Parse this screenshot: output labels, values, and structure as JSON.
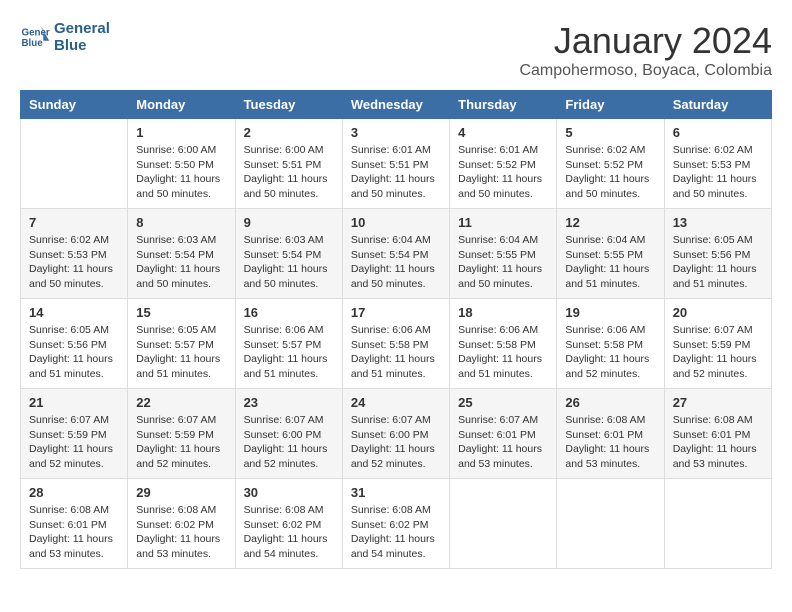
{
  "header": {
    "logo_line1": "General",
    "logo_line2": "Blue",
    "month_year": "January 2024",
    "location": "Campohermoso, Boyaca, Colombia"
  },
  "days_of_week": [
    "Sunday",
    "Monday",
    "Tuesday",
    "Wednesday",
    "Thursday",
    "Friday",
    "Saturday"
  ],
  "weeks": [
    [
      {
        "day": "",
        "sunrise": "",
        "sunset": "",
        "daylight": ""
      },
      {
        "day": "1",
        "sunrise": "6:00 AM",
        "sunset": "5:50 PM",
        "daylight": "11 hours and 50 minutes."
      },
      {
        "day": "2",
        "sunrise": "6:00 AM",
        "sunset": "5:51 PM",
        "daylight": "11 hours and 50 minutes."
      },
      {
        "day": "3",
        "sunrise": "6:01 AM",
        "sunset": "5:51 PM",
        "daylight": "11 hours and 50 minutes."
      },
      {
        "day": "4",
        "sunrise": "6:01 AM",
        "sunset": "5:52 PM",
        "daylight": "11 hours and 50 minutes."
      },
      {
        "day": "5",
        "sunrise": "6:02 AM",
        "sunset": "5:52 PM",
        "daylight": "11 hours and 50 minutes."
      },
      {
        "day": "6",
        "sunrise": "6:02 AM",
        "sunset": "5:53 PM",
        "daylight": "11 hours and 50 minutes."
      }
    ],
    [
      {
        "day": "7",
        "sunrise": "6:02 AM",
        "sunset": "5:53 PM",
        "daylight": "11 hours and 50 minutes."
      },
      {
        "day": "8",
        "sunrise": "6:03 AM",
        "sunset": "5:54 PM",
        "daylight": "11 hours and 50 minutes."
      },
      {
        "day": "9",
        "sunrise": "6:03 AM",
        "sunset": "5:54 PM",
        "daylight": "11 hours and 50 minutes."
      },
      {
        "day": "10",
        "sunrise": "6:04 AM",
        "sunset": "5:54 PM",
        "daylight": "11 hours and 50 minutes."
      },
      {
        "day": "11",
        "sunrise": "6:04 AM",
        "sunset": "5:55 PM",
        "daylight": "11 hours and 50 minutes."
      },
      {
        "day": "12",
        "sunrise": "6:04 AM",
        "sunset": "5:55 PM",
        "daylight": "11 hours and 51 minutes."
      },
      {
        "day": "13",
        "sunrise": "6:05 AM",
        "sunset": "5:56 PM",
        "daylight": "11 hours and 51 minutes."
      }
    ],
    [
      {
        "day": "14",
        "sunrise": "6:05 AM",
        "sunset": "5:56 PM",
        "daylight": "11 hours and 51 minutes."
      },
      {
        "day": "15",
        "sunrise": "6:05 AM",
        "sunset": "5:57 PM",
        "daylight": "11 hours and 51 minutes."
      },
      {
        "day": "16",
        "sunrise": "6:06 AM",
        "sunset": "5:57 PM",
        "daylight": "11 hours and 51 minutes."
      },
      {
        "day": "17",
        "sunrise": "6:06 AM",
        "sunset": "5:58 PM",
        "daylight": "11 hours and 51 minutes."
      },
      {
        "day": "18",
        "sunrise": "6:06 AM",
        "sunset": "5:58 PM",
        "daylight": "11 hours and 51 minutes."
      },
      {
        "day": "19",
        "sunrise": "6:06 AM",
        "sunset": "5:58 PM",
        "daylight": "11 hours and 52 minutes."
      },
      {
        "day": "20",
        "sunrise": "6:07 AM",
        "sunset": "5:59 PM",
        "daylight": "11 hours and 52 minutes."
      }
    ],
    [
      {
        "day": "21",
        "sunrise": "6:07 AM",
        "sunset": "5:59 PM",
        "daylight": "11 hours and 52 minutes."
      },
      {
        "day": "22",
        "sunrise": "6:07 AM",
        "sunset": "5:59 PM",
        "daylight": "11 hours and 52 minutes."
      },
      {
        "day": "23",
        "sunrise": "6:07 AM",
        "sunset": "6:00 PM",
        "daylight": "11 hours and 52 minutes."
      },
      {
        "day": "24",
        "sunrise": "6:07 AM",
        "sunset": "6:00 PM",
        "daylight": "11 hours and 52 minutes."
      },
      {
        "day": "25",
        "sunrise": "6:07 AM",
        "sunset": "6:01 PM",
        "daylight": "11 hours and 53 minutes."
      },
      {
        "day": "26",
        "sunrise": "6:08 AM",
        "sunset": "6:01 PM",
        "daylight": "11 hours and 53 minutes."
      },
      {
        "day": "27",
        "sunrise": "6:08 AM",
        "sunset": "6:01 PM",
        "daylight": "11 hours and 53 minutes."
      }
    ],
    [
      {
        "day": "28",
        "sunrise": "6:08 AM",
        "sunset": "6:01 PM",
        "daylight": "11 hours and 53 minutes."
      },
      {
        "day": "29",
        "sunrise": "6:08 AM",
        "sunset": "6:02 PM",
        "daylight": "11 hours and 53 minutes."
      },
      {
        "day": "30",
        "sunrise": "6:08 AM",
        "sunset": "6:02 PM",
        "daylight": "11 hours and 54 minutes."
      },
      {
        "day": "31",
        "sunrise": "6:08 AM",
        "sunset": "6:02 PM",
        "daylight": "11 hours and 54 minutes."
      },
      {
        "day": "",
        "sunrise": "",
        "sunset": "",
        "daylight": ""
      },
      {
        "day": "",
        "sunrise": "",
        "sunset": "",
        "daylight": ""
      },
      {
        "day": "",
        "sunrise": "",
        "sunset": "",
        "daylight": ""
      }
    ]
  ],
  "labels": {
    "sunrise": "Sunrise:",
    "sunset": "Sunset:",
    "daylight": "Daylight:"
  }
}
